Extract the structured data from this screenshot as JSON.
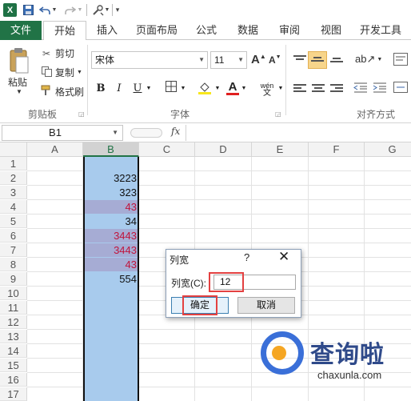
{
  "qat": {
    "logo": "X",
    "save_icon": "save-icon",
    "undo_icon": "undo-icon",
    "redo_icon": "redo-icon"
  },
  "tabs": [
    "文件",
    "开始",
    "插入",
    "页面布局",
    "公式",
    "数据",
    "审阅",
    "视图",
    "开发工具"
  ],
  "ribbon": {
    "clipboard": {
      "paste": "粘贴",
      "cut": "剪切",
      "copy": "复制",
      "format_painter": "格式刷",
      "label": "剪贴板"
    },
    "font": {
      "name": "宋体",
      "size": "11",
      "grow": "A",
      "shrink": "A",
      "bold": "B",
      "italic": "I",
      "underline": "U",
      "color_letter": "A",
      "wen": "wén",
      "label": "字体"
    },
    "alignment": {
      "label": "对齐方式"
    }
  },
  "formula_bar": {
    "name_box": "B1",
    "fx": "fx",
    "value": ""
  },
  "grid": {
    "columns": [
      "A",
      "B",
      "C",
      "D",
      "E",
      "F",
      "G"
    ],
    "rows": [
      "1",
      "2",
      "3",
      "4",
      "5",
      "6",
      "7",
      "8",
      "9",
      "10",
      "11",
      "12",
      "13",
      "14",
      "15",
      "16",
      "17"
    ],
    "b_values": [
      "",
      "3223",
      "323",
      "43",
      "34",
      "3443",
      "3443",
      "43",
      "554"
    ],
    "red_rows": [
      4,
      6,
      7,
      8
    ]
  },
  "dialog": {
    "title": "列宽",
    "help": "?",
    "label": "列宽(C):",
    "value": "12",
    "ok": "确定",
    "cancel": "取消"
  },
  "watermark": {
    "brand": "查询啦",
    "site": "chaxunla.com"
  },
  "colors": {
    "excel_green": "#217346",
    "selection_blue": "#a8cbed",
    "highlight_red": "#e34141"
  }
}
